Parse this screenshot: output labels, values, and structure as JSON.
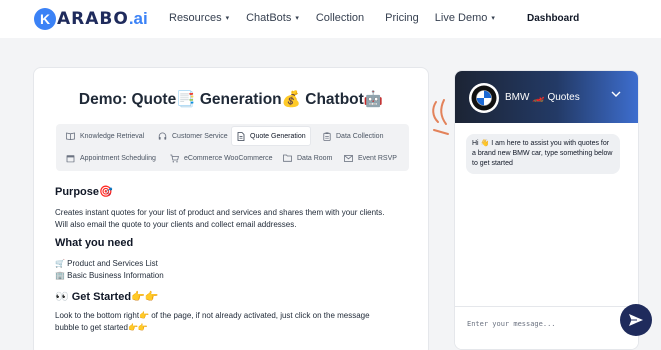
{
  "brand": {
    "logo_letter": "K",
    "logo_text": "ARABO",
    "logo_suffix": ".ai"
  },
  "nav": {
    "items": [
      {
        "label": "Resources",
        "has_dropdown": true
      },
      {
        "label": "ChatBots",
        "has_dropdown": true
      },
      {
        "label": "Collection",
        "has_dropdown": false
      },
      {
        "label": "Pricing",
        "has_dropdown": false
      },
      {
        "label": "Live Demo",
        "has_dropdown": true
      }
    ],
    "dashboard": "Dashboard"
  },
  "main": {
    "title": "Demo: Quote📑 Generation💰 Chatbot🤖",
    "tabs": [
      {
        "label": "Knowledge Retrieval",
        "icon": "book-icon",
        "active": false
      },
      {
        "label": "Customer Service",
        "icon": "headset-icon",
        "active": false
      },
      {
        "label": "Quote Generation",
        "icon": "quote-icon",
        "active": true
      },
      {
        "label": "Data Collection",
        "icon": "clipboard-icon",
        "active": false
      },
      {
        "label": "Appointment Scheduling",
        "icon": "calendar-icon",
        "active": false
      },
      {
        "label": "eCommerce WooCommerce",
        "icon": "cart-icon",
        "active": false
      },
      {
        "label": "Data Room",
        "icon": "folder-icon",
        "active": false
      },
      {
        "label": "Event RSVP",
        "icon": "envelope-icon",
        "active": false
      }
    ],
    "purpose_heading": "Purpose🎯",
    "purpose_line1": "Creates instant quotes for your list of product and services and shares them with your clients.",
    "purpose_line2": "Will also email the quote to your clients and collect email addresses.",
    "need_heading": "What you need",
    "need_item1": "🛒 Product and Services List",
    "need_item2": "🏢 Basic Business Information",
    "start_heading": "👀 Get Started👉👉",
    "start_line1": "Look to the bottom right👉 of the page, if not already activated, just click on the message",
    "start_line2": "bubble to get started👉👉"
  },
  "chat": {
    "title": "BMW 🏎️ Quotes",
    "message": "Hi 👋 I am here to assist you with quotes for a brand new BMW car, type something below to get started",
    "input_placeholder": "Enter your message...",
    "colors": {
      "header_start": "#1c2434",
      "header_end": "#3e6fd1",
      "send_button": "#1f2b5c"
    }
  }
}
